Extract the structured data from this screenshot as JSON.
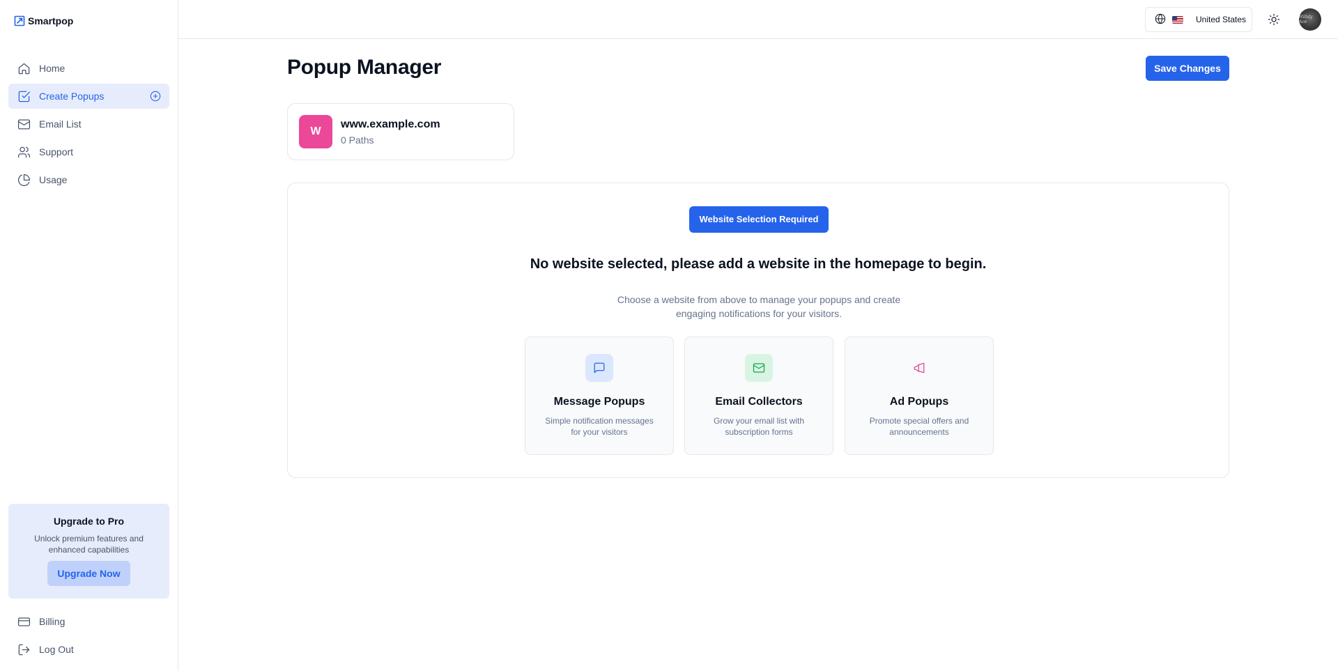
{
  "brand": {
    "name": "Smartpop"
  },
  "sidebar": {
    "items": [
      {
        "label": "Home",
        "icon": "home-icon"
      },
      {
        "label": "Create Popups",
        "icon": "check-square-icon",
        "active": true
      },
      {
        "label": "Email List",
        "icon": "mail-icon"
      },
      {
        "label": "Support",
        "icon": "users-icon"
      },
      {
        "label": "Usage",
        "icon": "pie-chart-icon"
      }
    ],
    "upgrade": {
      "title": "Upgrade to Pro",
      "text": "Unlock premium features and enhanced capabilities",
      "button": "Upgrade Now"
    },
    "bottom": [
      {
        "label": "Billing",
        "icon": "credit-card-icon"
      },
      {
        "label": "Log Out",
        "icon": "log-out-icon"
      }
    ]
  },
  "header": {
    "country": "United States",
    "avatar_text": "Hillsly Ace"
  },
  "main": {
    "title": "Popup Manager",
    "save_label": "Save Changes",
    "site": {
      "initial": "W",
      "url": "www.example.com",
      "paths": "0 Paths"
    },
    "panel": {
      "badge": "Website Selection Required",
      "heading": "No website selected, please add a website in the homepage to begin.",
      "description": "Choose a website from above to manage your popups and create engaging notifications for your visitors.",
      "features": [
        {
          "title": "Message Popups",
          "text": "Simple notification messages for your visitors",
          "icon": "message-icon"
        },
        {
          "title": "Email Collectors",
          "text": "Grow your email list with subscription forms",
          "icon": "mail-icon"
        },
        {
          "title": "Ad Popups",
          "text": "Promote special offers and announcements",
          "icon": "megaphone-icon"
        }
      ]
    }
  },
  "colors": {
    "primary": "#2563eb",
    "active_bg": "#e6ecfc",
    "pink": "#ec4899",
    "green": "#16a34a"
  }
}
